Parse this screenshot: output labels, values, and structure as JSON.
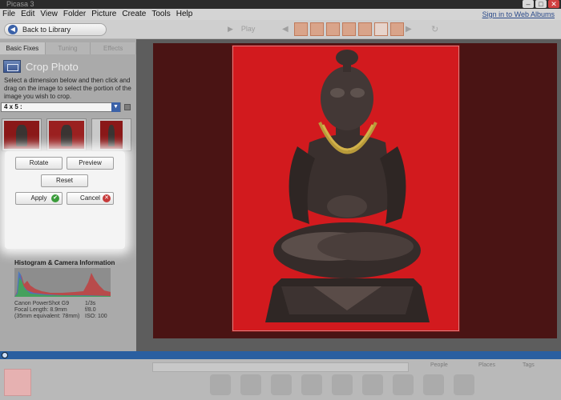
{
  "window": {
    "title": "Picasa 3"
  },
  "menu": {
    "items": [
      "File",
      "Edit",
      "View",
      "Folder",
      "Picture",
      "Create",
      "Tools",
      "Help"
    ],
    "signin": "Sign in to Web Albums"
  },
  "toolbar": {
    "back_label": "Back to Library",
    "play_label": "Play"
  },
  "left_panel": {
    "tabs": [
      "Basic Fixes",
      "Tuning",
      "Effects"
    ],
    "crop_title": "Crop Photo",
    "crop_description": "Select a dimension below and then click and drag on the image to select the portion of the image you wish to crop.",
    "ratio_selected": "4 x 5 :",
    "buttons": {
      "rotate": "Rotate",
      "preview": "Preview",
      "reset": "Reset",
      "apply": "Apply",
      "cancel": "Cancel"
    },
    "histogram_title": "Histogram & Camera Information",
    "camera": {
      "model": "Canon PowerShot G9",
      "shutter": "1/3s",
      "focal_label": "Focal Length: 8.9mm",
      "aperture": "f/8.0",
      "equivalent_label": "(35mm equivalent: 78mm)",
      "iso": "ISO: 100"
    }
  },
  "tray": {
    "people": "People",
    "places": "Places",
    "tags": "Tags"
  },
  "colors": {
    "accent": "#3b62a8",
    "photo_background": "#d21a1e",
    "status_bar": "#2a5fa0"
  }
}
